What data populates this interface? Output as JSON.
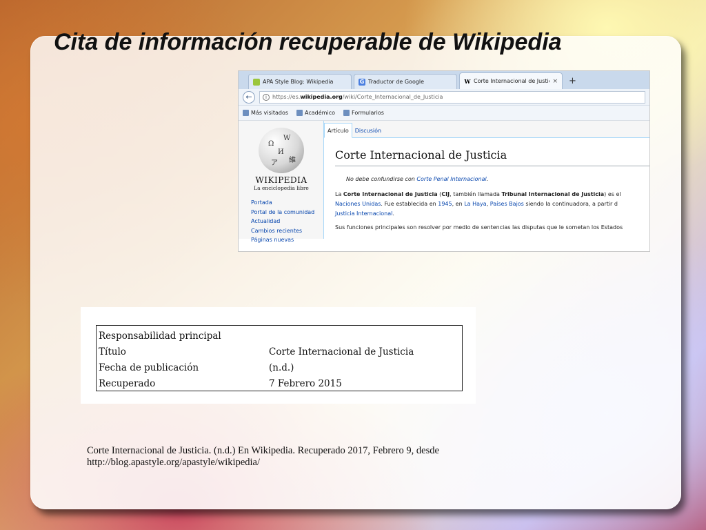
{
  "slide": {
    "title": "Cita de información recuperable de Wikipedia"
  },
  "browser": {
    "tabs": [
      {
        "label": "APA Style Blog: Wikipedia",
        "icon": "apa-favicon-icon",
        "active": false
      },
      {
        "label": "Traductor de Google",
        "icon": "google-translate-icon",
        "active": false
      },
      {
        "label": "Corte Internacional de Justici...",
        "icon": "wikipedia-w-icon",
        "active": true
      }
    ],
    "new_tab": "+",
    "close_glyph": "×",
    "url_prefix": "https://es.",
    "url_domain": "wikipedia.org",
    "url_path": "/wiki/Corte_Internacional_de_Justicia",
    "bookmarks": [
      "Más visitados",
      "Académico",
      "Formularios"
    ]
  },
  "wiki": {
    "wordmark": "WIKIPEDIA",
    "tagline": "La enciclopedia libre",
    "sidebar": [
      "Portada",
      "Portal de la comunidad",
      "Actualidad",
      "Cambios recientes",
      "Páginas nuevas"
    ],
    "page_tabs": [
      "Artículo",
      "Discusión"
    ],
    "article_title": "Corte Internacional de Justicia",
    "hatnote_prefix": "No debe confundirse con ",
    "hatnote_link": "Corte Penal Internacional",
    "hatnote_suffix": ".",
    "p1_a": "La ",
    "p1_b": "Corte Internacional de Justicia",
    "p1_c": " (",
    "p1_d": "CIJ",
    "p1_e": ", también llamada ",
    "p1_f": "Tribunal Internacional de Justicia",
    "p1_g": ") es el",
    "p2_a": "Naciones Unidas",
    "p2_b": ". Fue establecida en ",
    "p2_c": "1945",
    "p2_d": ", en ",
    "p2_e": "La Haya",
    "p2_f": ", ",
    "p2_g": "Países Bajos",
    "p2_h": " siendo la continuadora, a partir d",
    "p3_a": "Justicia Internacional",
    "p3_b": ".",
    "p4": "Sus funciones principales son resolver por medio de sentencias las disputas que le sometan los Estados"
  },
  "ref_table": {
    "rows": [
      {
        "key": "Responsabilidad principal",
        "value": ""
      },
      {
        "key": "Título",
        "value": "Corte Internacional de Justicia"
      },
      {
        "key": "Fecha de publicación",
        "value": "(n.d.)"
      },
      {
        "key": "Recuperado",
        "value": "7 Febrero 2015"
      }
    ]
  },
  "citation": {
    "line1": "Corte Internacional de Justicia. (n.d.) En Wikipedia. Recuperado  2017, Febrero 9, desde",
    "line2": "http://blog.apastyle.org/apastyle/wikipedia/"
  }
}
